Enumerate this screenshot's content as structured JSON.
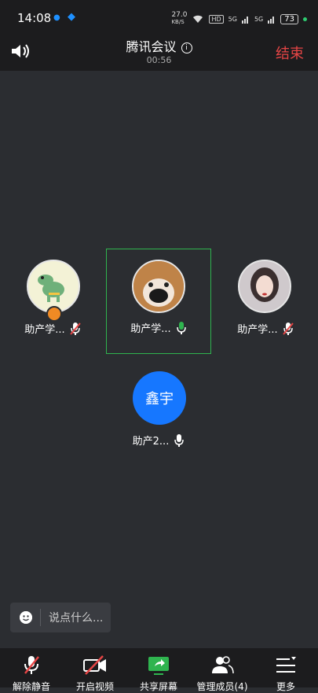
{
  "status": {
    "time": "14:08",
    "net_speed": "27.0",
    "net_unit": "KB/S",
    "hd": "HD",
    "sig1": "5G",
    "sig2": "5G",
    "battery": "73"
  },
  "header": {
    "title": "腾讯会议",
    "timer": "00:56",
    "end_label": "结束"
  },
  "participants": [
    {
      "name": "助产学...",
      "mic": "muted"
    },
    {
      "name": "助产学...",
      "mic": "active"
    },
    {
      "name": "助产学...",
      "mic": "muted"
    },
    {
      "name": "助产2...",
      "mic": "active",
      "avatar_text": "鑫宇"
    }
  ],
  "chat": {
    "placeholder": "说点什么..."
  },
  "toolbar": {
    "unmute": "解除静音",
    "video": "开启视频",
    "share": "共享屏幕",
    "members": "管理成员(4)",
    "more": "更多"
  },
  "colors": {
    "accent_green": "#2fb44f",
    "end_red": "#e64545",
    "avatar_blue": "#1677ff"
  }
}
